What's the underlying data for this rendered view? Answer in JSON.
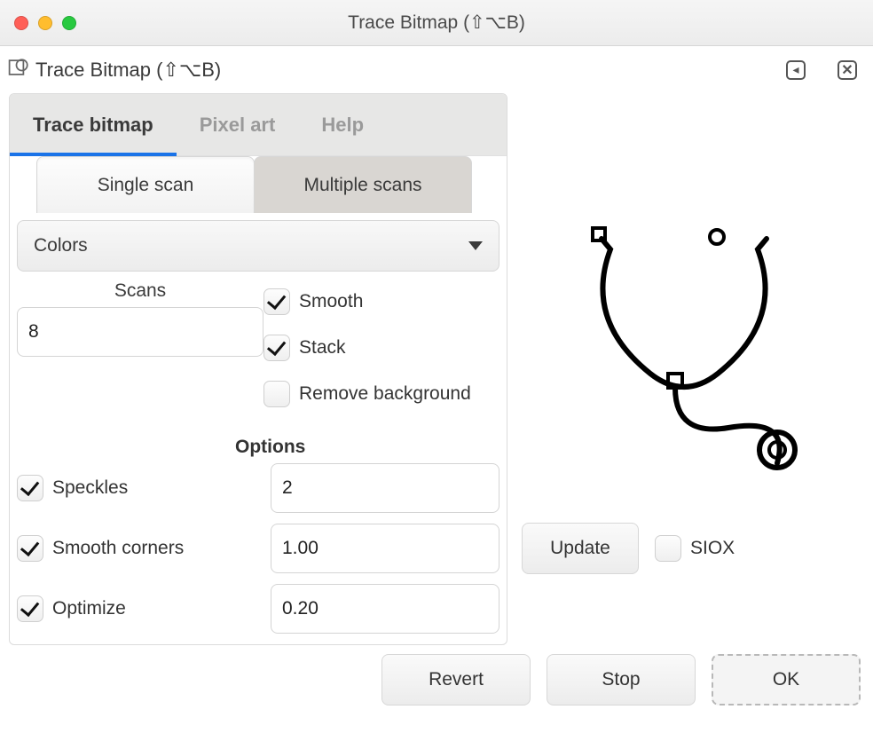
{
  "window": {
    "title": "Trace Bitmap (⇧⌥B)"
  },
  "header": {
    "title": "Trace Bitmap (⇧⌥B)"
  },
  "tabs": {
    "trace": "Trace bitmap",
    "pixel": "Pixel art",
    "help": "Help"
  },
  "subtabs": {
    "single": "Single scan",
    "multiple": "Multiple scans"
  },
  "mode_dropdown": {
    "label": "Colors"
  },
  "scans": {
    "label": "Scans",
    "value": "8"
  },
  "checks": {
    "smooth": "Smooth",
    "stack": "Stack",
    "remove_bg": "Remove background"
  },
  "options_heading": "Options",
  "options": {
    "speckles": {
      "label": "Speckles",
      "value": "2"
    },
    "smooth_corners": {
      "label": "Smooth corners",
      "value": "1.00"
    },
    "optimize": {
      "label": "Optimize",
      "value": "0.20"
    }
  },
  "preview": {
    "update": "Update",
    "siox": "SIOX"
  },
  "footer": {
    "revert": "Revert",
    "stop": "Stop",
    "ok": "OK"
  }
}
